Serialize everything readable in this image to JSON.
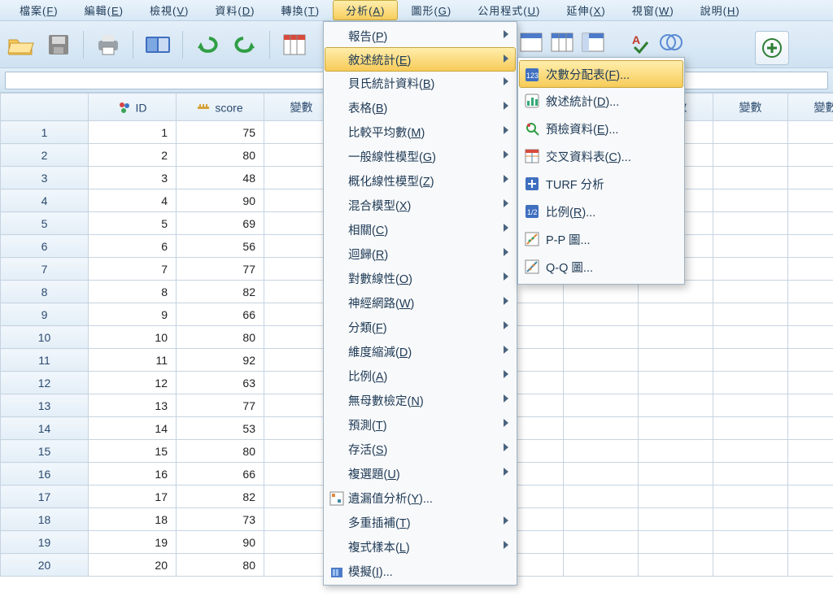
{
  "menubar": {
    "items": [
      {
        "label": "檔案",
        "mn": "F"
      },
      {
        "label": "編輯",
        "mn": "E"
      },
      {
        "label": "檢視",
        "mn": "V"
      },
      {
        "label": "資料",
        "mn": "D"
      },
      {
        "label": "轉換",
        "mn": "T"
      },
      {
        "label": "分析",
        "mn": "A",
        "open": true
      },
      {
        "label": "圖形",
        "mn": "G"
      },
      {
        "label": "公用程式",
        "mn": "U"
      },
      {
        "label": "延伸",
        "mn": "X"
      },
      {
        "label": "視窗",
        "mn": "W"
      },
      {
        "label": "說明",
        "mn": "H"
      }
    ]
  },
  "columns": {
    "corner": "",
    "id_col": "ID",
    "score_col": "score",
    "var_label": "變數"
  },
  "rows": [
    {
      "n": "1",
      "id": "1",
      "score": "75"
    },
    {
      "n": "2",
      "id": "2",
      "score": "80"
    },
    {
      "n": "3",
      "id": "3",
      "score": "48"
    },
    {
      "n": "4",
      "id": "4",
      "score": "90"
    },
    {
      "n": "5",
      "id": "5",
      "score": "69"
    },
    {
      "n": "6",
      "id": "6",
      "score": "56"
    },
    {
      "n": "7",
      "id": "7",
      "score": "77"
    },
    {
      "n": "8",
      "id": "8",
      "score": "82"
    },
    {
      "n": "9",
      "id": "9",
      "score": "66"
    },
    {
      "n": "10",
      "id": "10",
      "score": "80"
    },
    {
      "n": "11",
      "id": "11",
      "score": "92"
    },
    {
      "n": "12",
      "id": "12",
      "score": "63"
    },
    {
      "n": "13",
      "id": "13",
      "score": "77"
    },
    {
      "n": "14",
      "id": "14",
      "score": "53"
    },
    {
      "n": "15",
      "id": "15",
      "score": "80"
    },
    {
      "n": "16",
      "id": "16",
      "score": "66"
    },
    {
      "n": "17",
      "id": "17",
      "score": "82"
    },
    {
      "n": "18",
      "id": "18",
      "score": "73"
    },
    {
      "n": "19",
      "id": "19",
      "score": "90"
    },
    {
      "n": "20",
      "id": "20",
      "score": "80"
    }
  ],
  "analyze_menu": [
    {
      "label": "報告",
      "mn": "P",
      "sub": true
    },
    {
      "label": "敘述統計",
      "mn": "E",
      "sub": true,
      "hl": true
    },
    {
      "label": "貝氏統計資料",
      "mn": "B",
      "sub": true
    },
    {
      "label": "表格",
      "mn": "B",
      "sub": true
    },
    {
      "label": "比較平均數",
      "mn": "M",
      "sub": true
    },
    {
      "label": "一般線性模型",
      "mn": "G",
      "sub": true
    },
    {
      "label": "概化線性模型",
      "mn": "Z",
      "sub": true
    },
    {
      "label": "混合模型",
      "mn": "X",
      "sub": true
    },
    {
      "label": "相關",
      "mn": "C",
      "sub": true
    },
    {
      "label": "迴歸",
      "mn": "R",
      "sub": true
    },
    {
      "label": "對數線性",
      "mn": "O",
      "sub": true
    },
    {
      "label": "神經網路",
      "mn": "W",
      "sub": true
    },
    {
      "label": "分類",
      "mn": "F",
      "sub": true
    },
    {
      "label": "維度縮減",
      "mn": "D",
      "sub": true
    },
    {
      "label": "比例",
      "mn": "A",
      "sub": true
    },
    {
      "label": "無母數檢定",
      "mn": "N",
      "sub": true
    },
    {
      "label": "預測",
      "mn": "T",
      "sub": true
    },
    {
      "label": "存活",
      "mn": "S",
      "sub": true
    },
    {
      "label": "複選題",
      "mn": "U",
      "sub": true
    },
    {
      "label": "遺漏值分析",
      "mn": "Y",
      "sub": false,
      "icon": "mva",
      "dots": true
    },
    {
      "label": "多重插補",
      "mn": "T",
      "sub": true
    },
    {
      "label": "複式樣本",
      "mn": "L",
      "sub": true
    },
    {
      "label": "模擬",
      "mn": "I",
      "sub": false,
      "icon": "sim",
      "dots": true
    }
  ],
  "desc_submenu": [
    {
      "label": "次數分配表",
      "mn": "F",
      "dots": true,
      "hl": true,
      "icon": "freq"
    },
    {
      "label": "敘述統計",
      "mn": "D",
      "dots": true,
      "icon": "desc"
    },
    {
      "label": "預檢資料",
      "mn": "E",
      "dots": true,
      "icon": "explore"
    },
    {
      "label": "交叉資料表",
      "mn": "C",
      "dots": true,
      "icon": "cross"
    },
    {
      "label": "TURF 分析",
      "mn": "",
      "dots": false,
      "icon": "turf"
    },
    {
      "label": "比例",
      "mn": "R",
      "dots": true,
      "icon": "ratio"
    },
    {
      "label": "P-P 圖",
      "mn": "",
      "dots": true,
      "icon": "pp"
    },
    {
      "label": "Q-Q 圖",
      "mn": "",
      "dots": true,
      "icon": "qq"
    }
  ]
}
